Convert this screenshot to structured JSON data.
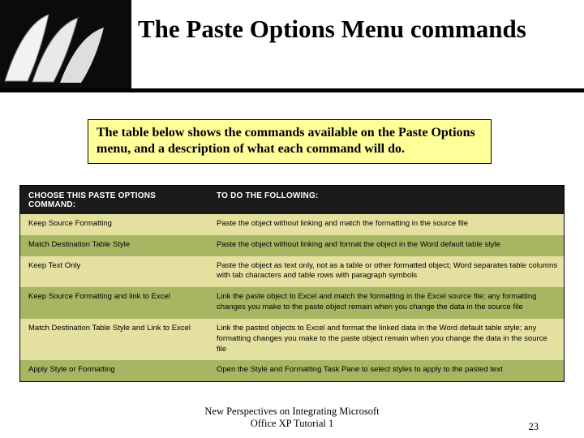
{
  "header": {
    "title": "The Paste Options Menu commands",
    "image_alt": "sydney-opera-sails-photo"
  },
  "intro": {
    "text": "The table below shows the commands available on the Paste Options menu, and a description of what each command will do."
  },
  "table": {
    "headers": {
      "col0": "CHOOSE THIS PASTE OPTIONS COMMAND:",
      "col1": "TO DO THE FOLLOWING:"
    },
    "rows": [
      {
        "cmd": "Keep Source Formatting",
        "desc": "Paste the object without linking and match the formatting in the source file"
      },
      {
        "cmd": "Match Destination Table Style",
        "desc": "Paste the object without linking and format the object in the Word default table style"
      },
      {
        "cmd": "Keep Text Only",
        "desc": "Paste the object as text only, not as a table or other formatted object; Word separates table columns with tab characters and table rows with paragraph symbols"
      },
      {
        "cmd": "Keep Source Formatting and link to Excel",
        "desc": "Link the paste object to Excel and match the formatting in the Excel source file; any formatting changes you make to the paste object remain when you change the data in the source file"
      },
      {
        "cmd": "Match Destination Table Style and Link to Excel",
        "desc": "Link the pasted objects to Excel and format the linked data in the Word default table style; any formatting changes you make to the paste object remain when you change the data in the source file"
      },
      {
        "cmd": "Apply Style or Formatting",
        "desc": "Open the Style and Formatting Task Pane to select styles to apply to the pasted text"
      }
    ]
  },
  "footer": {
    "source_line1": "New Perspectives on Integrating Microsoft",
    "source_line2": "Office XP Tutorial 1",
    "page_number": "23"
  }
}
